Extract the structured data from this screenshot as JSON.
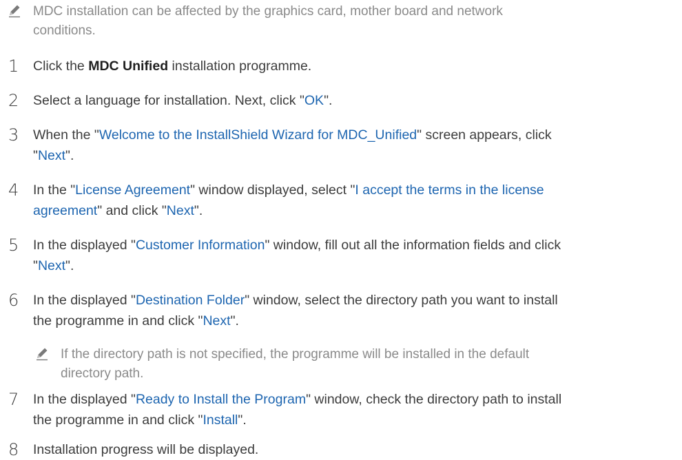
{
  "note_top": {
    "line1": "MDC installation can be affected by the graphics card, mother board and network",
    "line2": "conditions."
  },
  "steps": [
    {
      "num": "1",
      "l1_a": "Click the ",
      "l1_b": "MDC Unified",
      "l1_c": " installation programme."
    },
    {
      "num": "2",
      "l1_a": "Select a language for installation. Next, click \"",
      "l1_b": "OK",
      "l1_c": "\"."
    },
    {
      "num": "3",
      "l1_a": "When the \"",
      "l1_b": "Welcome to the InstallShield Wizard for MDC_Unified",
      "l1_c": "\" screen appears, click",
      "l2_a": "\"",
      "l2_b": "Next",
      "l2_c": "\"."
    },
    {
      "num": "4",
      "l1_a": "In the \"",
      "l1_b": "License Agreement",
      "l1_c": "\" window displayed, select \"",
      "l1_d": "I accept the terms in the license",
      "l2_a": "agreement",
      "l2_b": "\" and click \"",
      "l2_c": "Next",
      "l2_d": "\"."
    },
    {
      "num": "5",
      "l1_a": "In the displayed \"",
      "l1_b": "Customer Information",
      "l1_c": "\" window, fill out all the information fields and click",
      "l2_a": "\"",
      "l2_b": "Next",
      "l2_c": "\"."
    },
    {
      "num": "6",
      "l1_a": "In the displayed \"",
      "l1_b": "Destination Folder",
      "l1_c": "\" window, select the directory path you want to install",
      "l2_a": "the programme in and click \"",
      "l2_b": "Next",
      "l2_c": "\"."
    },
    {
      "num": "7",
      "l1_a": "In the displayed \"",
      "l1_b": "Ready to Install the Program",
      "l1_c": "\" window, check the directory path to install",
      "l2_a": "the programme in and click \"",
      "l2_b": "Install",
      "l2_c": "\"."
    },
    {
      "num": "8",
      "l1_a": "Installation progress will be displayed."
    }
  ],
  "note_step6": {
    "line1": "If the directory path is not specified, the programme will be installed in the default",
    "line2": "directory path."
  },
  "colors": {
    "link": "#1d65b0",
    "body_text": "#3c3c3c",
    "note_text": "#8a8a8a"
  },
  "icons": {
    "note": "pencil-icon"
  }
}
